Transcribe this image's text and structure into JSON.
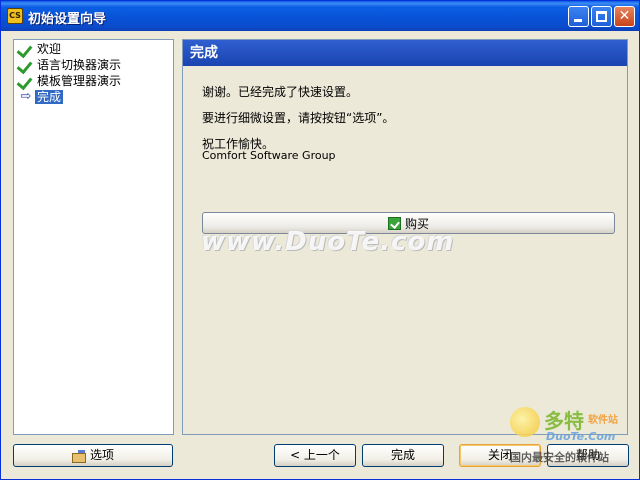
{
  "window": {
    "title": "初始设置向导",
    "app_icon": "CS"
  },
  "titlebar": {
    "minimize": "minimize-icon",
    "maximize": "maximize-icon",
    "close": "✕"
  },
  "nav": {
    "items": [
      {
        "label": "欢迎",
        "state": "done"
      },
      {
        "label": "语言切换器演示",
        "state": "done"
      },
      {
        "label": "模板管理器演示",
        "state": "done"
      },
      {
        "label": "完成",
        "state": "current"
      }
    ]
  },
  "content": {
    "header": "完成",
    "line1": "谢谢。已经完成了快速设置。",
    "line2": "要进行细微设置，请按按钮“选项”。",
    "line3": "祝工作愉快。",
    "line4": "Comfort Software Group",
    "buy_label": "购买"
  },
  "watermark": "www.DuoTe.com",
  "buttons": {
    "options": "选项",
    "back": "< 上一个",
    "finish": "完成",
    "close": "关闭",
    "help": "帮助"
  },
  "logo": {
    "big": "多特",
    "small": "软件站",
    "url": "DuoTe.Com",
    "sub": "国内最安全的软件站"
  }
}
